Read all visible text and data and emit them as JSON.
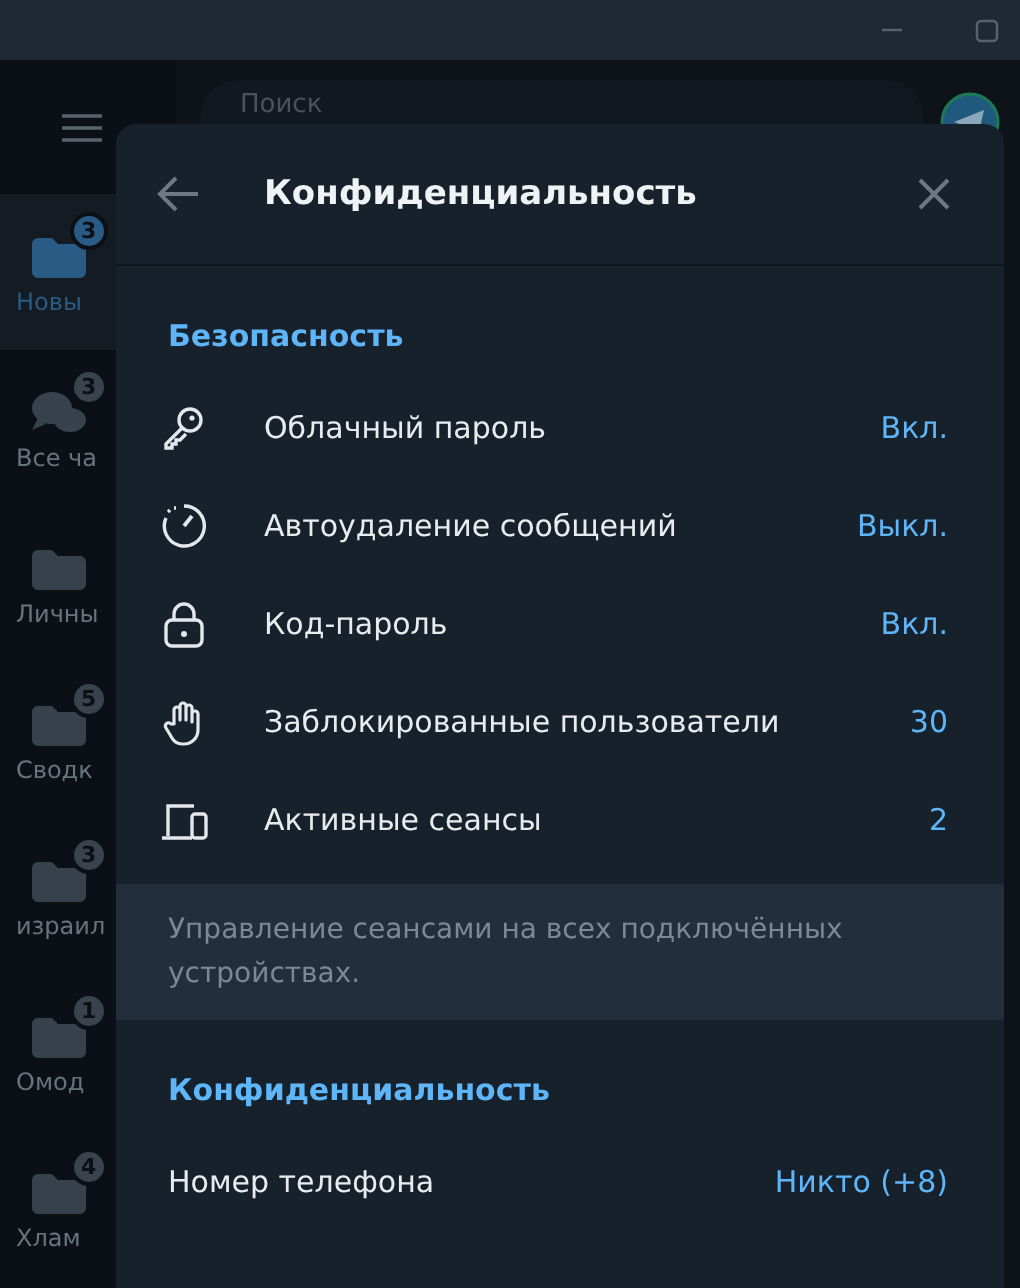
{
  "search": {
    "placeholder": "Поиск"
  },
  "folders": [
    {
      "label": "Новы",
      "badge": "3",
      "kind": "folder",
      "selected": true
    },
    {
      "label": "Все ча",
      "badge": "3",
      "kind": "chats",
      "selected": false
    },
    {
      "label": "Личны",
      "kind": "folder",
      "selected": false
    },
    {
      "label": "Сводк",
      "badge": "5",
      "kind": "folder",
      "selected": false
    },
    {
      "label": "израил",
      "badge": "3",
      "kind": "folder",
      "selected": false
    },
    {
      "label": "Омод",
      "badge": "1",
      "kind": "folder",
      "selected": false
    },
    {
      "label": "Хлам",
      "badge": "4",
      "kind": "folder",
      "selected": false
    }
  ],
  "dialog": {
    "title": "Конфиденциальность",
    "sections": [
      {
        "title": "Безопасность",
        "rows": [
          {
            "kind": "key",
            "label": "Облачный пароль",
            "value": "Вкл."
          },
          {
            "kind": "timer",
            "label": "Автоудаление сообщений",
            "value": "Выкл."
          },
          {
            "kind": "lock",
            "label": "Код-пароль",
            "value": "Вкл."
          },
          {
            "kind": "hand",
            "label": "Заблокированные пользователи",
            "value": "30"
          },
          {
            "kind": "devices",
            "label": "Активные сеансы",
            "value": "2"
          }
        ],
        "note": "Управление сеансами на всех подключённых устройствах."
      },
      {
        "title": "Конфиденциальность",
        "rows": [
          {
            "kind": "plain",
            "label": "Номер телефона",
            "value": "Никто (+8)"
          }
        ]
      }
    ]
  }
}
